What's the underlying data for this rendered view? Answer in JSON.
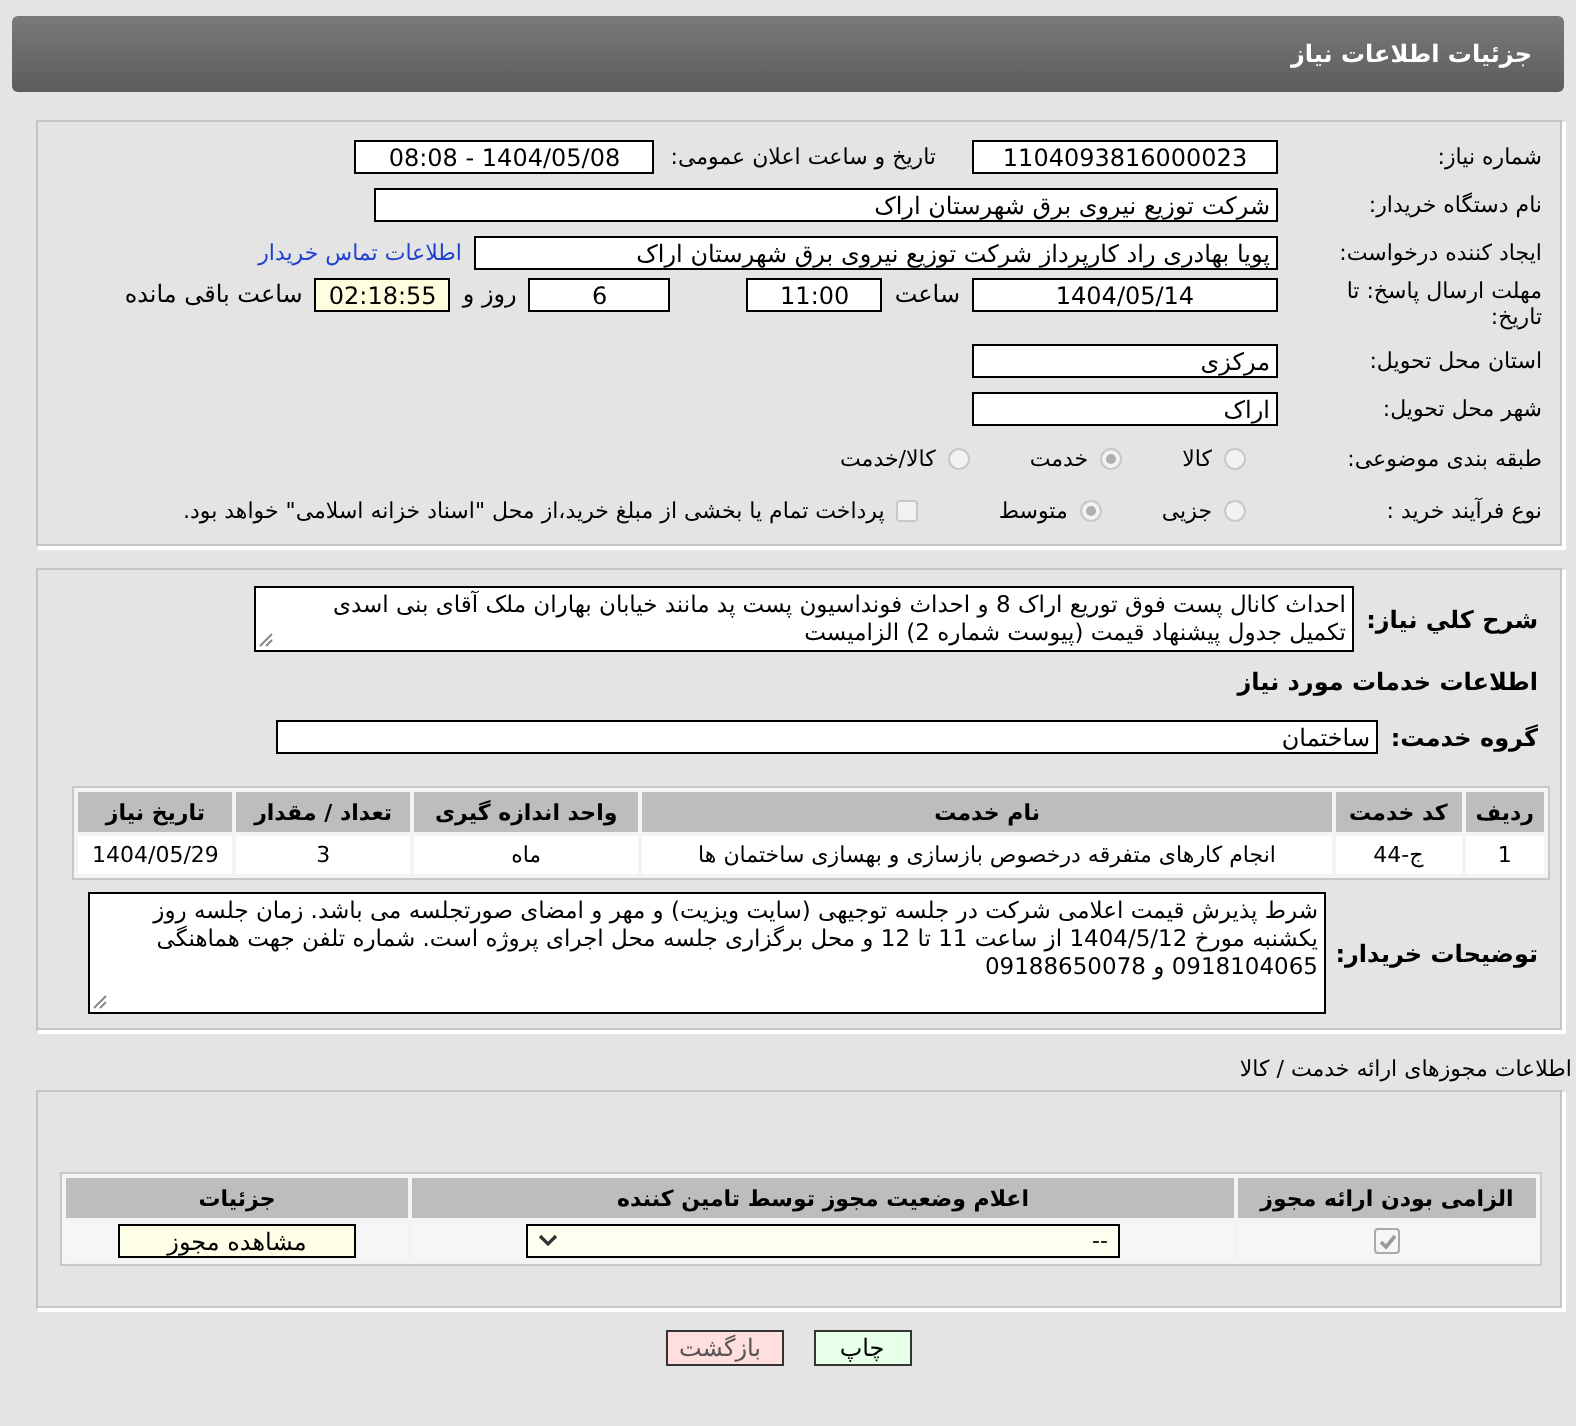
{
  "header": {
    "title": "جزئیات اطلاعات نیاز"
  },
  "details": {
    "need_number": {
      "label": "شماره نیاز:",
      "value": "1104093816000023"
    },
    "announce": {
      "label": "تاریخ و ساعت اعلان عمومی:",
      "value": "1404/05/08 - 08:08"
    },
    "buyer_org": {
      "label": "نام دستگاه خریدار:",
      "value": "شرکت توزیع نیروی برق شهرستان اراک"
    },
    "requester": {
      "label": "ایجاد کننده درخواست:",
      "value": "پویا بهادری راد کارپرداز شرکت توزیع نیروی برق شهرستان اراک",
      "link": "اطلاعات تماس خریدار"
    },
    "deadline": {
      "label": "مهلت ارسال پاسخ: تا تاریخ:",
      "date": "1404/05/14",
      "time_label": "ساعت",
      "time": "11:00",
      "days": "6",
      "days_label": "روز و",
      "remaining": "02:18:55",
      "remaining_label": "ساعت باقی مانده"
    },
    "province": {
      "label": "استان محل تحویل:",
      "value": "مرکزی"
    },
    "city": {
      "label": "شهر محل تحویل:",
      "value": "اراک"
    },
    "category": {
      "label": "طبقه بندی موضوعی:",
      "options": [
        {
          "label": "کالا",
          "selected": false
        },
        {
          "label": "خدمت",
          "selected": true
        },
        {
          "label": "کالا/خدمت",
          "selected": false
        }
      ]
    },
    "process": {
      "label": "نوع فرآیند خرید :",
      "options": [
        {
          "label": "جزیی",
          "selected": false
        },
        {
          "label": "متوسط",
          "selected": true
        }
      ],
      "payment": {
        "label": "پرداخت تمام یا بخشی از مبلغ خرید،از محل \"اسناد خزانه اسلامی\" خواهد بود.",
        "checked": false
      }
    }
  },
  "description": {
    "label": "شرح کلي نياز:",
    "text": "احداث کانال پست فوق توریع اراک 8 و احداث فونداسیون پست پد مانند خیابان بهاران ملک آقای بنی اسدی تکمیل جدول پیشنهاد قیمت (پیوست شماره 2) الزامیست"
  },
  "services_title": "اطلاعات خدمات مورد نیاز",
  "service_group": {
    "label": "گروه خدمت:",
    "value": "ساختمان"
  },
  "services_table": {
    "columns": [
      "ردیف",
      "کد خدمت",
      "نام خدمت",
      "واحد اندازه گیری",
      "تعداد / مقدار",
      "تاریخ نیاز"
    ],
    "rows": [
      [
        "1",
        "ج-44",
        "انجام کارهای متفرقه درخصوص بازسازی و بهسازی ساختمان ها",
        "ماه",
        "3",
        "1404/05/29"
      ]
    ]
  },
  "buyer_notes": {
    "label": "توضیحات خریدار:",
    "text": "شرط پذیرش قیمت اعلامی شرکت در جلسه توجیهی (سایت ویزیت) و مهر و امضای صورتجلسه می باشد. زمان جلسه روز یکشنبه مورخ 1404/5/12 از ساعت 11 تا 12 و محل برگزاری جلسه محل اجرای پروژه است. شماره تلفن جهت هماهنگی 0918104065 و 09188650078"
  },
  "permits_title": "اطلاعات مجوزهای ارائه خدمت / کالا",
  "permits_table": {
    "columns": [
      "الزامی بودن ارائه مجوز",
      "اعلام وضعیت مجوز توسط تامین کننده",
      "جزئیات"
    ],
    "rows": [
      {
        "required": true,
        "status": "--",
        "button": "مشاهده مجوز"
      }
    ]
  },
  "buttons": [
    {
      "label": "چاپ",
      "kind": "print"
    },
    {
      "label": "بازگشت",
      "kind": "back"
    }
  ]
}
